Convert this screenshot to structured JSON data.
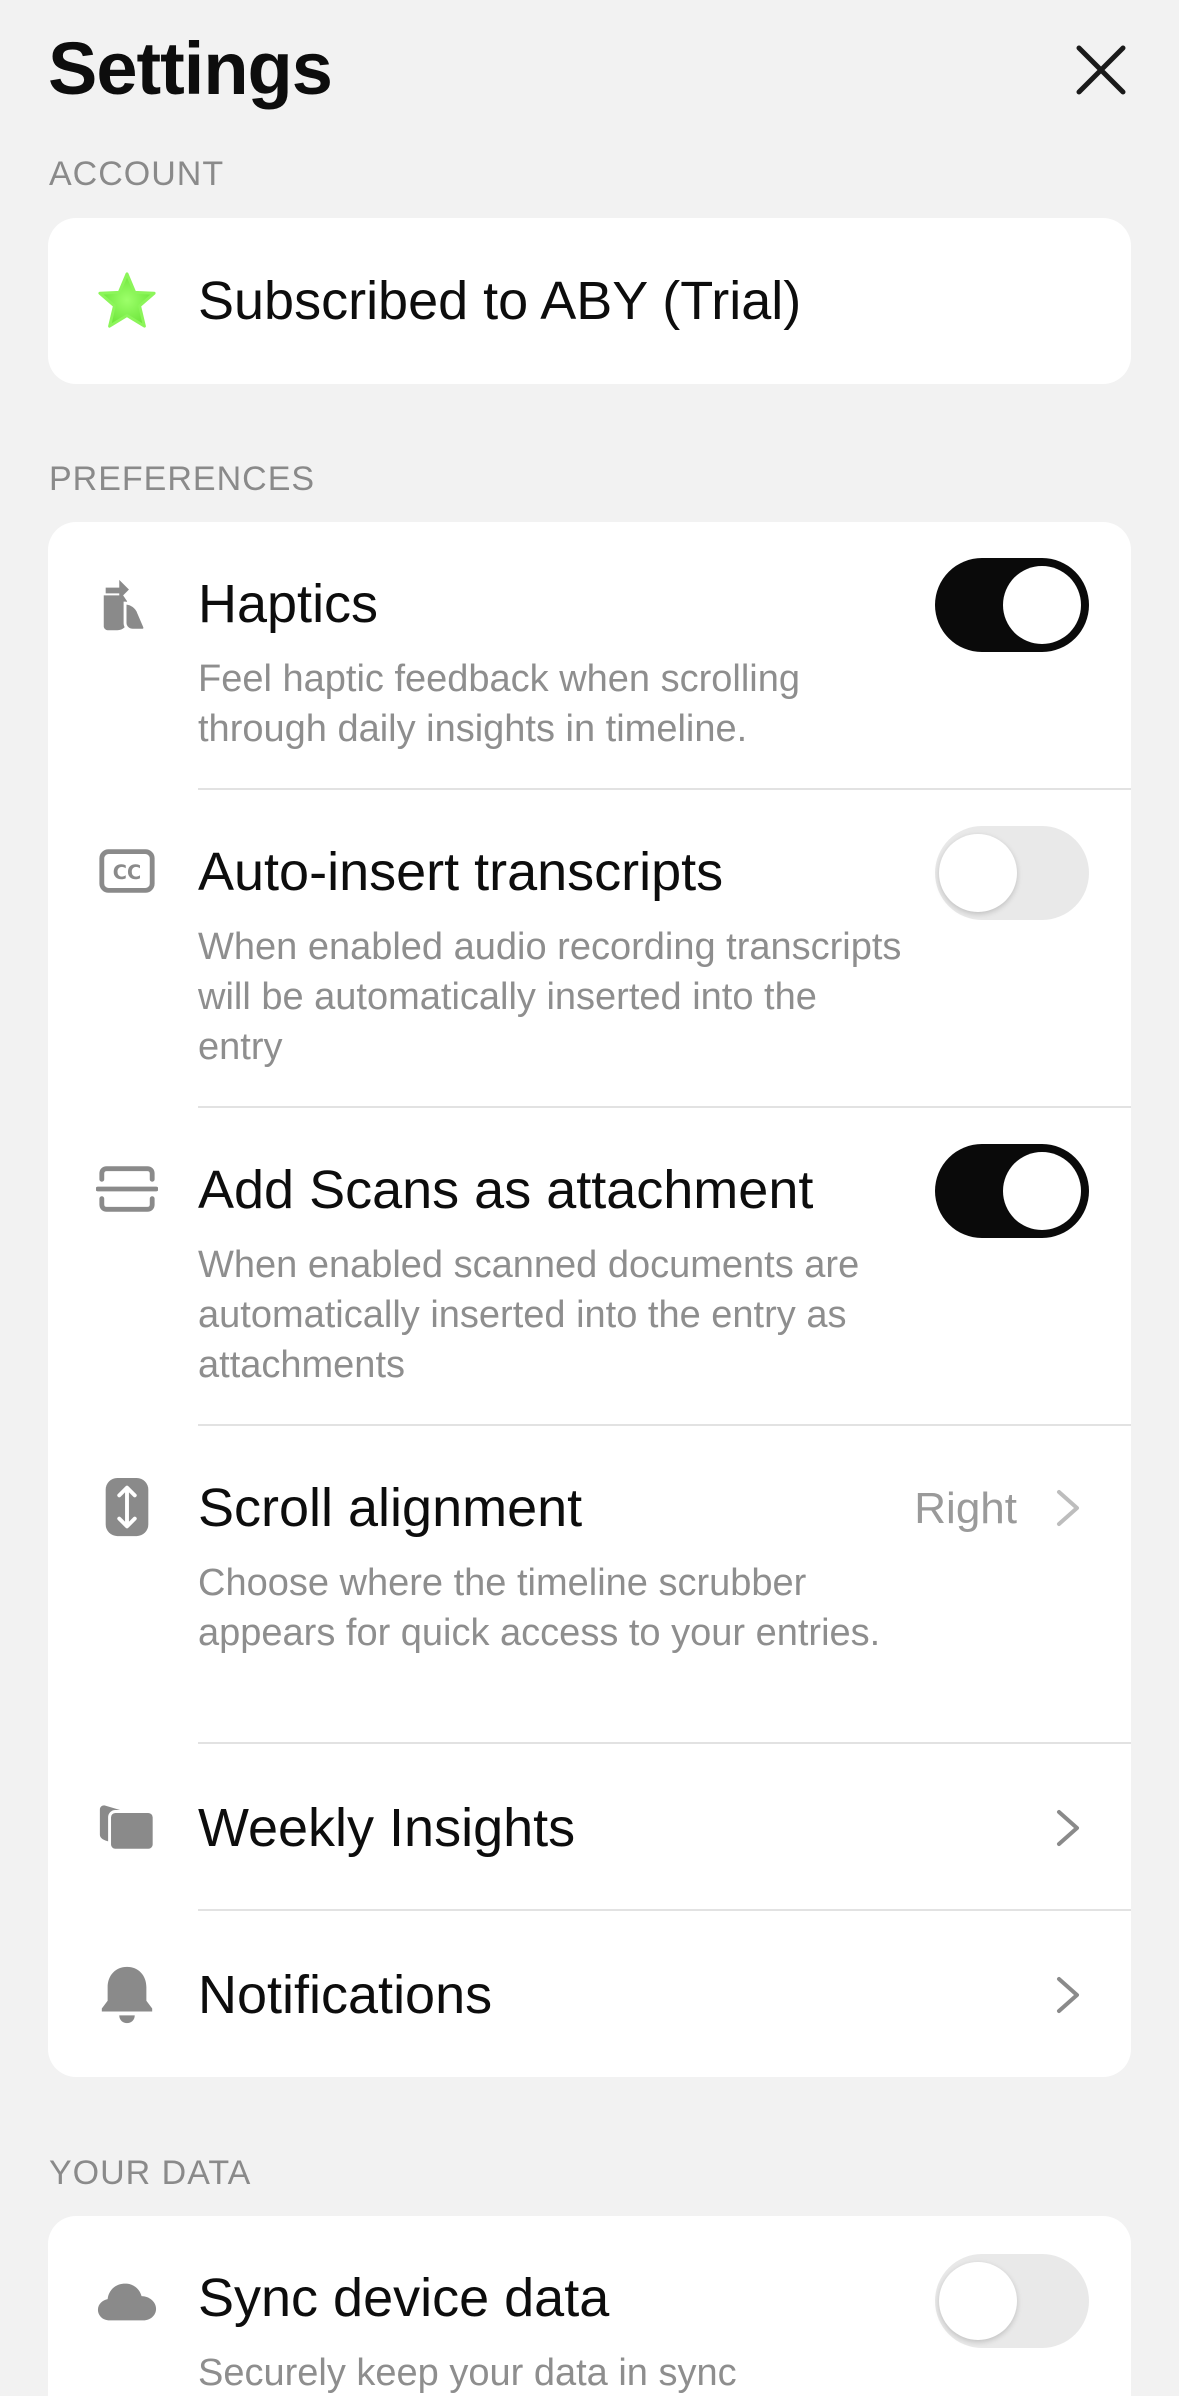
{
  "header": {
    "title": "Settings"
  },
  "account": {
    "section_label": "ACCOUNT",
    "subscription_label": "Subscribed to ABY (Trial)"
  },
  "preferences": {
    "section_label": "PREFERENCES",
    "haptics": {
      "title": "Haptics",
      "description": "Feel haptic feedback when scrolling through daily insights in timeline.",
      "enabled": true
    },
    "auto_insert": {
      "title": "Auto-insert transcripts",
      "description": "When enabled audio recording transcripts will be automatically inserted into the entry",
      "enabled": false
    },
    "scans": {
      "title": "Add Scans as attachment",
      "description": "When enabled scanned documents are automatically inserted into the entry as attachments",
      "enabled": true
    },
    "scroll_alignment": {
      "title": "Scroll alignment",
      "value": "Right",
      "description": "Choose where the timeline scrubber appears for quick access to your entries."
    },
    "weekly_insights": {
      "title": "Weekly Insights"
    },
    "notifications": {
      "title": "Notifications"
    }
  },
  "your_data": {
    "section_label": "YOUR DATA",
    "sync": {
      "title": "Sync device data",
      "description": "Securely keep your data in sync",
      "enabled": false
    }
  },
  "colors": {
    "accent_star": "#7cf04a",
    "toggle_on": "#0a0a0a",
    "toggle_off": "#e9e9e9",
    "icon_gray": "#8a8a8a"
  }
}
